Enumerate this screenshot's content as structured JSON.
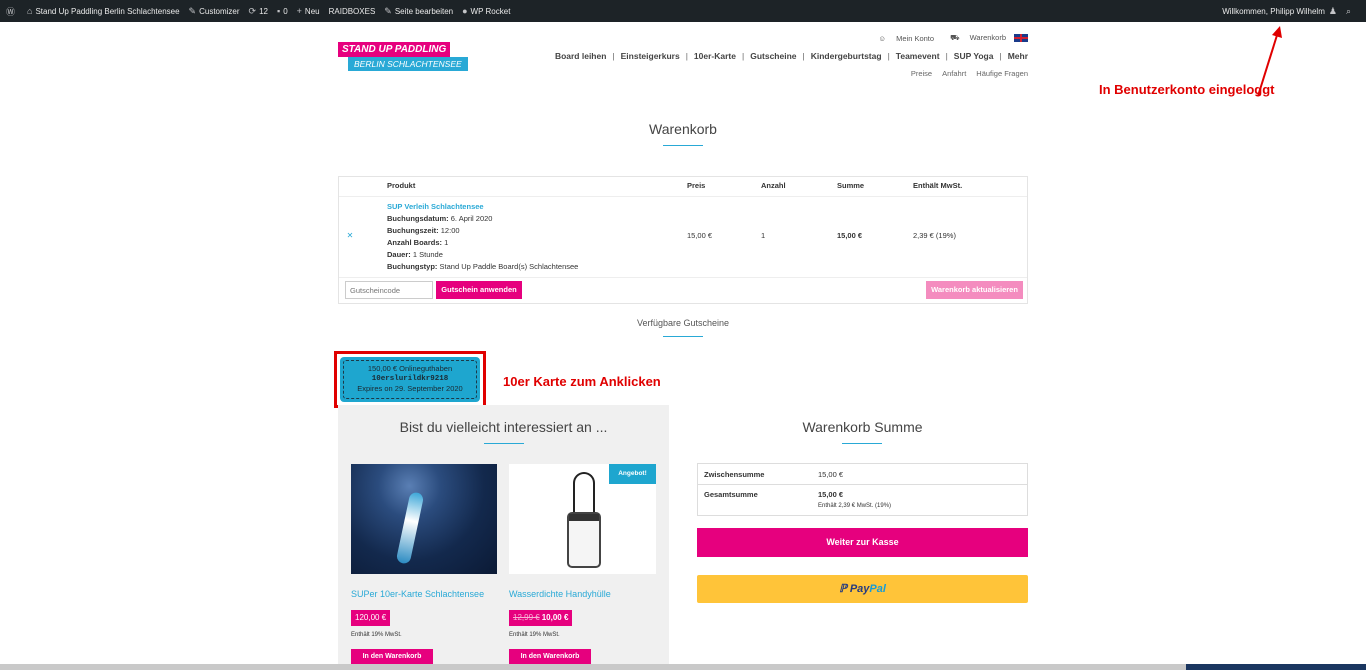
{
  "adminbar": {
    "site": "Stand Up Paddling Berlin Schlachtensee",
    "customizer": "Customizer",
    "updates": "12",
    "comments": "0",
    "new": "Neu",
    "raidboxes": "RAIDBOXES",
    "edit": "Seite bearbeiten",
    "rocket": "WP Rocket",
    "welcome": "Willkommen, Philipp Wilhelm"
  },
  "logo": {
    "line1": "STAND UP PADDLING",
    "line2": "BERLIN SCHLACHTENSEE"
  },
  "toplinks": {
    "account": "Mein Konto",
    "cart": "Warenkorb"
  },
  "nav": [
    "Board leihen",
    "Einsteigerkurs",
    "10er-Karte",
    "Gutscheine",
    "Kindergeburtstag",
    "Teamevent",
    "SUP Yoga",
    "Mehr"
  ],
  "subnav": [
    "Preise",
    "Anfahrt",
    "Häufige Fragen"
  ],
  "annotations": {
    "logged_in": "In Benutzerkonto eingeloggt",
    "click_card": "10er Karte zum Anklicken"
  },
  "page_title": "Warenkorb",
  "cart": {
    "headers": {
      "product": "Produkt",
      "price": "Preis",
      "qty": "Anzahl",
      "total": "Summe",
      "tax": "Enthält MwSt."
    },
    "item": {
      "name": "SUP Verleih Schlachtensee",
      "lines": [
        {
          "label": "Buchungsdatum:",
          "value": "6. April 2020"
        },
        {
          "label": "Buchungszeit:",
          "value": "12:00"
        },
        {
          "label": "Anzahl Boards:",
          "value": "1"
        },
        {
          "label": "Dauer:",
          "value": "1 Stunde"
        },
        {
          "label": "Buchungstyp:",
          "value": "Stand Up Paddle Board(s) Schlachtensee"
        }
      ],
      "price": "15,00 €",
      "qty": "1",
      "total": "15,00 €",
      "tax": "2,39 € (19%)"
    },
    "coupon_placeholder": "Gutscheincode",
    "apply_coupon": "Gutschein anwenden",
    "update_cart": "Warenkorb aktualisieren"
  },
  "available_coupons": "Verfügbare Gutscheine",
  "coupon_card": {
    "amount": "150,00 € Onlineguthaben",
    "code": "10erslurildkr9218",
    "expires": "Expires on 29. September 2020"
  },
  "upsell": {
    "title": "Bist du vielleicht interessiert an ...",
    "products": [
      {
        "title": "SUPer 10er-Karte Schlachtensee",
        "price": "120,00 €",
        "tax": "Enthält 19% MwSt.",
        "button": "In den Warenkorb"
      },
      {
        "title": "Wasserdichte Handyhülle",
        "old_price": "12,99 €",
        "price": "10,00 €",
        "tax": "Enthält 19% MwSt.",
        "button": "In den Warenkorb",
        "badge": "Angebot!"
      }
    ]
  },
  "totals": {
    "title": "Warenkorb Summe",
    "subtotal_label": "Zwischensumme",
    "subtotal": "15,00 €",
    "total_label": "Gesamtsumme",
    "total": "15,00 €",
    "total_tax": "Enthält 2,39 € MwSt. (19%)",
    "checkout": "Weiter zur Kasse",
    "paypal1": "Pay",
    "paypal2": "Pal"
  }
}
